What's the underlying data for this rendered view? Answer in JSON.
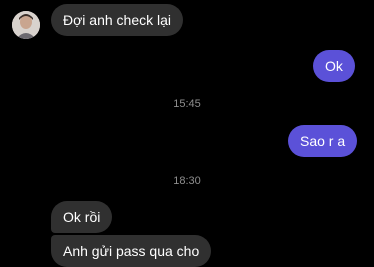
{
  "contact": {
    "avatar_icon": "profile-photo"
  },
  "messages": [
    {
      "direction": "incoming",
      "text": "Đợi anh check lại"
    },
    {
      "direction": "outgoing",
      "text": "Ok"
    },
    {
      "direction": "outgoing",
      "text": "Sao r a"
    },
    {
      "direction": "incoming",
      "text": "Ok rồi"
    },
    {
      "direction": "incoming",
      "text": "Anh gửi pass qua cho"
    }
  ],
  "timestamps": [
    "15:45",
    "18:30"
  ],
  "colors": {
    "background": "#000000",
    "incoming_bubble": "#303030",
    "outgoing_bubble": "#5b51d8",
    "timestamp_text": "#8e8e8e"
  }
}
